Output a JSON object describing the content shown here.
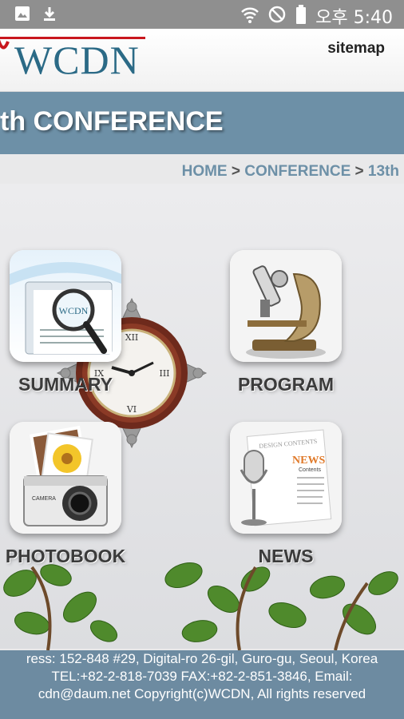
{
  "status_bar": {
    "time": "오후 5:40",
    "icons": [
      "gallery-icon",
      "download-icon",
      "wifi-icon",
      "do-not-disturb-icon",
      "battery-icon"
    ]
  },
  "header": {
    "logo_text": "WCDN",
    "sitemap_label": "sitemap"
  },
  "title_band": {
    "title": "th CONFERENCE"
  },
  "breadcrumb": {
    "items": [
      "HOME",
      "CONFERENCE",
      "13th"
    ],
    "separator": ">"
  },
  "menu": {
    "items": [
      {
        "label": "SUMMARY",
        "icon": "magnifier-document-icon"
      },
      {
        "label": "PROGRAM",
        "icon": "microscope-icon"
      },
      {
        "label": "PHOTOBOOK",
        "icon": "camera-photos-icon"
      },
      {
        "label": "NEWS",
        "icon": "microphone-newspaper-icon"
      }
    ]
  },
  "news_tile": {
    "heading": "NEWS",
    "subheading": "DESIGN CONTENTS",
    "contents": "Contents"
  },
  "photobook_tile": {
    "camera_text": "CAMERA"
  },
  "footer": {
    "line1": "ress: 152-848 #29, Digital-ro 26-gil, Guro-gu, Seoul, Korea",
    "line2": "TEL:+82-2-818-7039 FAX:+82-2-851-3846, Email:",
    "line3": "cdn@daum.net Copyright(c)WCDN, All rights reserved"
  },
  "colors": {
    "accent": "#6d90a7",
    "footer": "#6d8ba1",
    "status_bar": "#8f8f8f",
    "logo": "#2b6a86",
    "logo_red": "#c8161d"
  }
}
